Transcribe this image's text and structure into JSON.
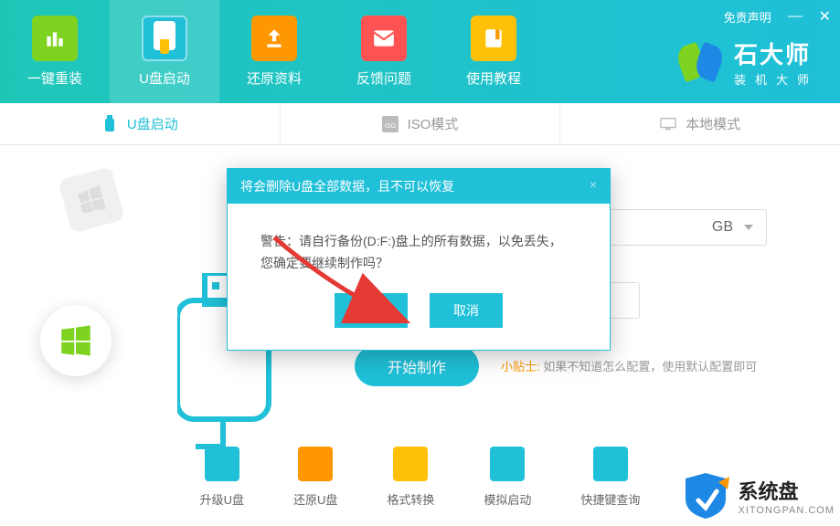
{
  "window": {
    "disclaimer": "免责声明",
    "minimize": "—",
    "close": "✕"
  },
  "brand": {
    "name": "石大师",
    "sub": "装机大师"
  },
  "nav": {
    "reinstall": "一键重装",
    "usb": "U盘启动",
    "restore": "还原资料",
    "feedback": "反馈问题",
    "tutorial": "使用教程"
  },
  "mode_tabs": {
    "usb": "U盘启动",
    "iso": "ISO模式",
    "local": "本地模式"
  },
  "form": {
    "size_suffix": "GB"
  },
  "start_button": "开始制作",
  "tip": {
    "label": "小贴士:",
    "text": "如果不知道怎么配置，使用默认配置即可"
  },
  "tools": {
    "upgrade": "升级U盘",
    "restore": "还原U盘",
    "format": "格式转换",
    "sim": "模拟启动",
    "shortcut": "快捷键查询"
  },
  "modal": {
    "title": "将会删除U盘全部数据，且不可以恢复",
    "line1": "警告：请自行备份(D:F:)盘上的所有数据，以免丢失，",
    "line2": "您确定要继续制作吗？",
    "confirm": "确定",
    "cancel": "取消"
  },
  "watermark": {
    "cn": "系统盘",
    "en": "XITONGPAN.COM"
  }
}
